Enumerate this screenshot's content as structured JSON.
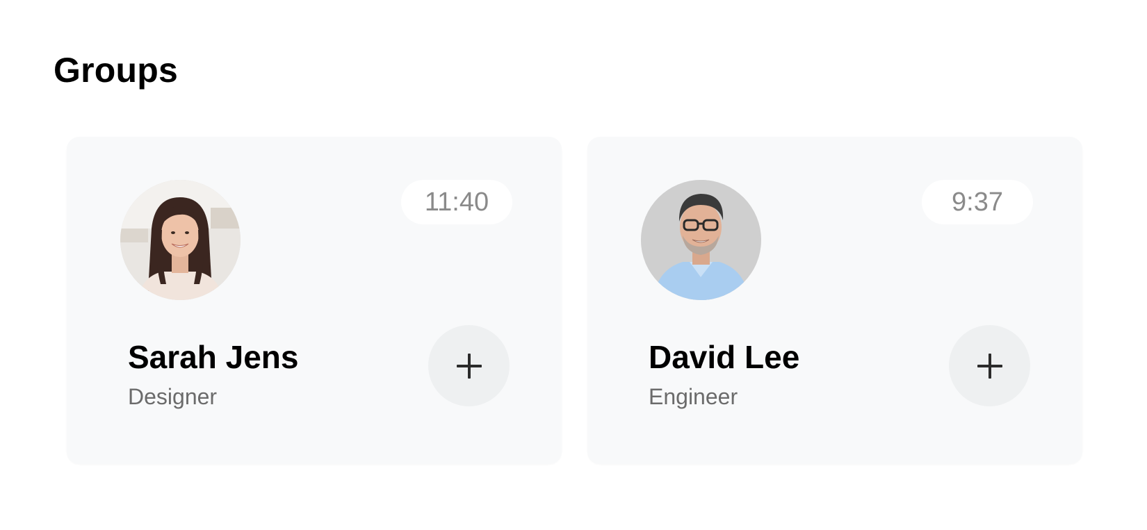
{
  "page": {
    "title": "Groups"
  },
  "cards": [
    {
      "name": "Sarah Jens",
      "role": "Designer",
      "time": "11:40",
      "avatar_icon": "avatar-photo",
      "add_icon": "plus-icon"
    },
    {
      "name": "David Lee",
      "role": "Engineer",
      "time": "9:37",
      "avatar_icon": "avatar-photo",
      "add_icon": "plus-icon"
    }
  ],
  "colors": {
    "background": "#ffffff",
    "card": "#f8f9fa",
    "pill": "#ffffff",
    "add_button": "#eef0f1",
    "name_text": "#000000",
    "role_text": "#6b6b6b",
    "time_text": "#8a8a8a"
  }
}
